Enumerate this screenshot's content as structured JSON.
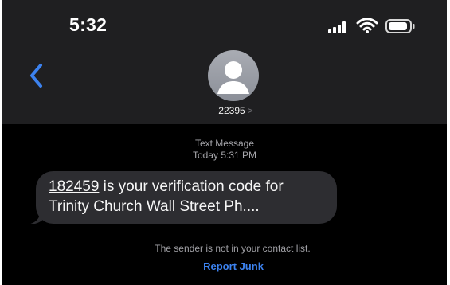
{
  "status_bar": {
    "time": "5:32",
    "signal_icon": "cellular-signal-icon",
    "wifi_icon": "wifi-icon",
    "battery_icon": "battery-icon"
  },
  "header": {
    "back_icon": "chevron-left-icon",
    "avatar_icon": "person-avatar-icon",
    "contact_name": "22395",
    "contact_chevron": ">"
  },
  "thread": {
    "message_type": "Text Message",
    "date_day": "Today",
    "date_time": "5:31 PM",
    "message": {
      "code": "182459",
      "line1_rest": " is your verification code for",
      "line2": "Trinity Church Wall Street Ph...."
    },
    "sender_notice": "The sender is not in your contact list.",
    "report_label": "Report Junk"
  },
  "colors": {
    "background": "#000000",
    "header": "#1f1f21",
    "bubble": "#2d2d31",
    "accent": "#3c82ef"
  }
}
